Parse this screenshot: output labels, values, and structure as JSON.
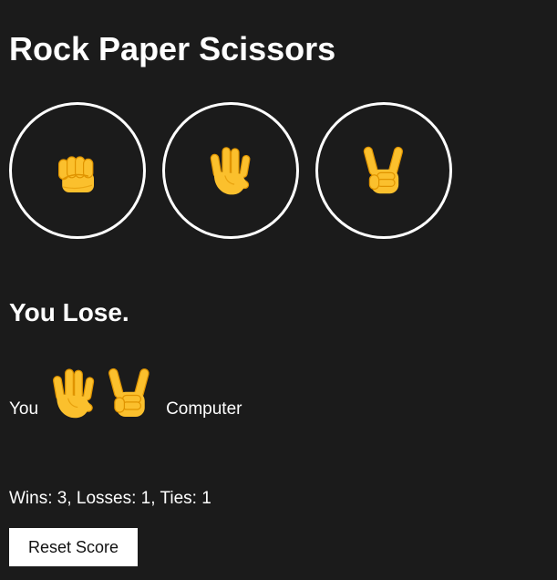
{
  "title": "Rock Paper Scissors",
  "choices": [
    {
      "name": "rock",
      "icon": "fist-icon"
    },
    {
      "name": "paper",
      "icon": "open-hand-icon"
    },
    {
      "name": "scissors",
      "icon": "victory-hand-icon"
    }
  ],
  "result": {
    "text": "You Lose.",
    "you_label": "You",
    "computer_label": "Computer",
    "you_move_icon": "open-hand-icon",
    "computer_move_icon": "victory-hand-icon"
  },
  "score": {
    "text": "Wins: 3, Losses: 1, Ties: 1",
    "wins": 3,
    "losses": 1,
    "ties": 1
  },
  "reset_label": "Reset Score",
  "colors": {
    "background": "#1b1b1b",
    "text": "#ffffff",
    "hand": "#fbc02d",
    "hand_outline": "#e09400"
  }
}
